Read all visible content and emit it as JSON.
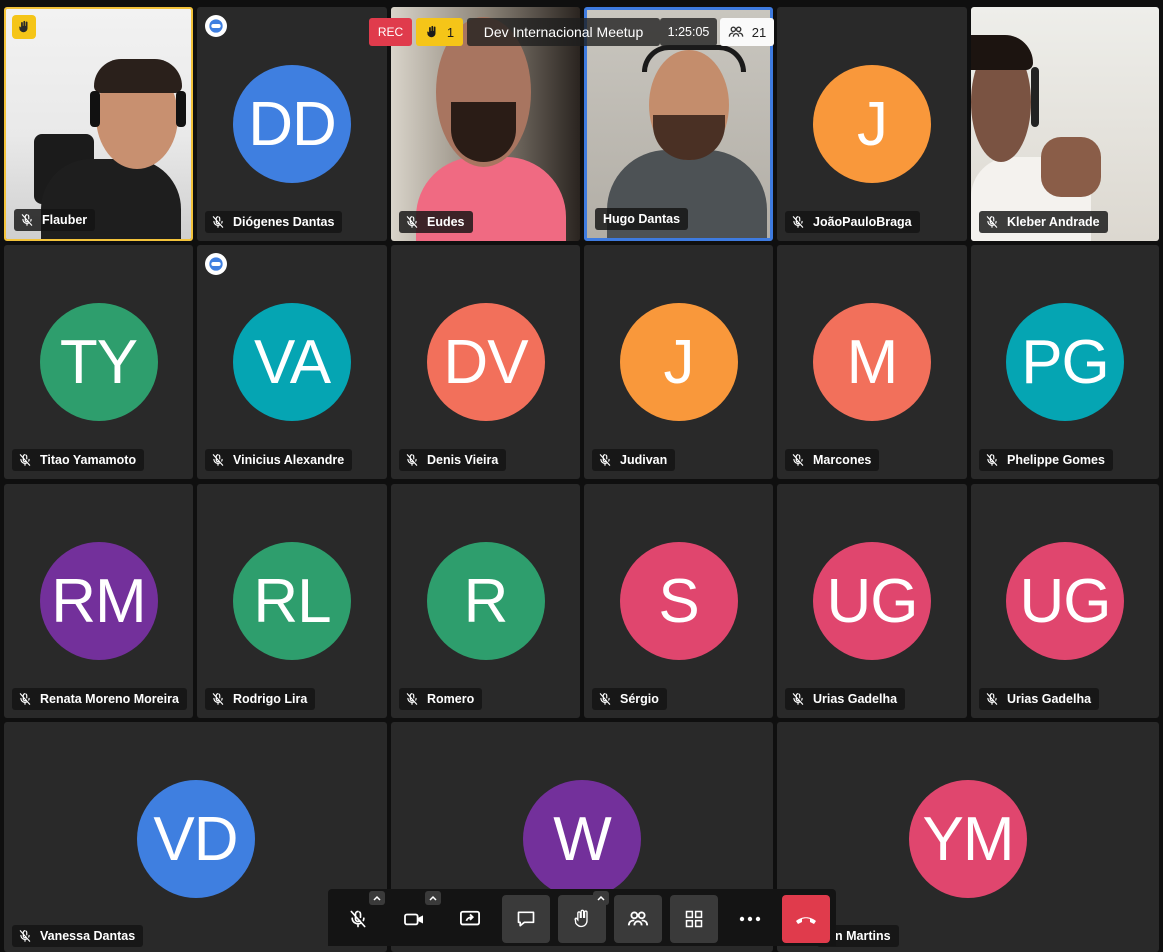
{
  "meeting": {
    "title": "Dev Internacional Meetup",
    "timer": "1:25:05",
    "participants_count": "21",
    "rec_label": "REC",
    "raised_hands": "1"
  },
  "colors": {
    "blue": "#3f7fe0",
    "teal": "#05a5b3",
    "orange": "#f9983b",
    "green": "#2e9e6d",
    "coral": "#f2705b",
    "purple": "#73309b",
    "pink": "#e0466e",
    "active_border": "#f3c33b",
    "speaker_border": "#3e7be0",
    "hangup": "#e03b4c"
  },
  "participants": [
    {
      "name": "Flauber",
      "video": true
    },
    {
      "name": "Diógenes Dantas",
      "initials": "DD",
      "color": "blue",
      "moderator": true
    },
    {
      "name": "Eudes",
      "video": true
    },
    {
      "name": "Hugo Dantas",
      "video": true
    },
    {
      "name": "JoãoPauloBraga",
      "initials": "J",
      "color": "orange"
    },
    {
      "name": "Kleber Andrade",
      "video": true
    },
    {
      "name": "Titao Yamamoto",
      "initials": "TY",
      "color": "green"
    },
    {
      "name": "Vinicius Alexandre",
      "initials": "VA",
      "color": "teal",
      "moderator": true
    },
    {
      "name": "Denis Vieira",
      "initials": "DV",
      "color": "coral"
    },
    {
      "name": "Judivan",
      "initials": "J",
      "color": "orange"
    },
    {
      "name": "Marcones",
      "initials": "M",
      "color": "coral"
    },
    {
      "name": "Phelippe Gomes",
      "initials": "PG",
      "color": "teal"
    },
    {
      "name": "Renata Moreno Moreira",
      "initials": "RM",
      "color": "purple"
    },
    {
      "name": "Rodrigo Lira",
      "initials": "RL",
      "color": "green"
    },
    {
      "name": "Romero",
      "initials": "R",
      "color": "green"
    },
    {
      "name": "Sérgio",
      "initials": "S",
      "color": "pink"
    },
    {
      "name": "Urias Gadelha",
      "initials": "UG",
      "color": "pink"
    },
    {
      "name": "Urias Gadelha",
      "initials": "UG",
      "color": "pink"
    },
    {
      "name": "Vanessa Dantas",
      "initials": "VD",
      "color": "blue"
    },
    {
      "name": "",
      "initials": "W",
      "color": "purple"
    },
    {
      "name": "n Martins",
      "initials": "YM",
      "color": "pink"
    }
  ],
  "toolbar": {
    "buttons": [
      "microphone-icon",
      "camera-icon",
      "share-screen-icon",
      "chat-icon",
      "raise-hand-icon",
      "participants-icon",
      "tile-view-icon",
      "more-icon",
      "hangup-icon"
    ]
  }
}
